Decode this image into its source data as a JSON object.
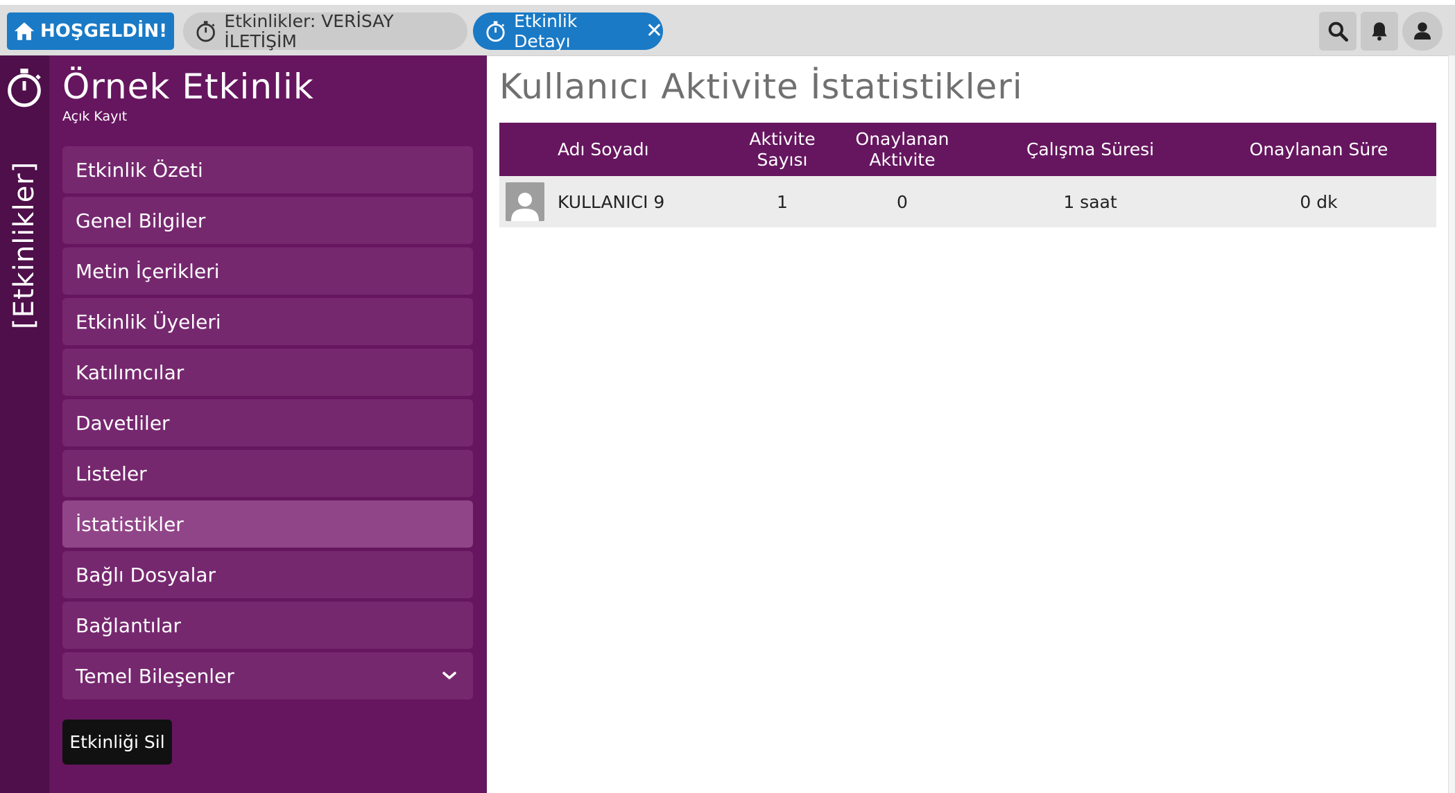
{
  "topbar": {
    "home_label": "HOŞGELDİN!",
    "tabs": [
      {
        "label": "Etkinlikler: VERİSAY İLETİŞİM",
        "icon": "stopwatch-icon"
      },
      {
        "label": "Etkinlik Detayı",
        "icon": "stopwatch-icon",
        "close": "✕"
      }
    ],
    "icons": [
      "search-icon",
      "bell-icon",
      "user-icon"
    ]
  },
  "rail": {
    "label": "[Etkinlikler]",
    "icon": "stopwatch-icon"
  },
  "sidebar": {
    "title": "Örnek Etkinlik",
    "subtitle": "Açık Kayıt",
    "items": [
      {
        "label": "Etkinlik Özeti"
      },
      {
        "label": "Genel Bilgiler"
      },
      {
        "label": "Metin İçerikleri"
      },
      {
        "label": "Etkinlik Üyeleri"
      },
      {
        "label": "Katılımcılar"
      },
      {
        "label": "Davetliler"
      },
      {
        "label": "Listeler"
      },
      {
        "label": "İstatistikler",
        "active": true
      },
      {
        "label": "Bağlı Dosyalar"
      },
      {
        "label": "Bağlantılar"
      },
      {
        "label": "Temel Bileşenler",
        "icon": "chevron-down-icon"
      }
    ],
    "delete_label": "Etkinliği Sil"
  },
  "main": {
    "title": "Kullanıcı Aktivite İstatistikleri",
    "table": {
      "headers": [
        "Adı Soyadı",
        "Aktivite Sayısı",
        "Onaylanan Aktivite",
        "Çalışma Süresi",
        "Onaylanan Süre"
      ],
      "header_activity_lines": [
        "Aktivite",
        "Sayısı"
      ],
      "rows": [
        {
          "name": "KULLANICI 9",
          "activity_count": "1",
          "approved_activity": "0",
          "work_time": "1 saat",
          "approved_time": "0 dk"
        }
      ]
    }
  },
  "colors": {
    "accent_blue": "#1a7ac6",
    "purple_dark": "#4e0f4a",
    "purple": "#66165f",
    "purple_item": "#76286f",
    "purple_active": "#914589"
  }
}
